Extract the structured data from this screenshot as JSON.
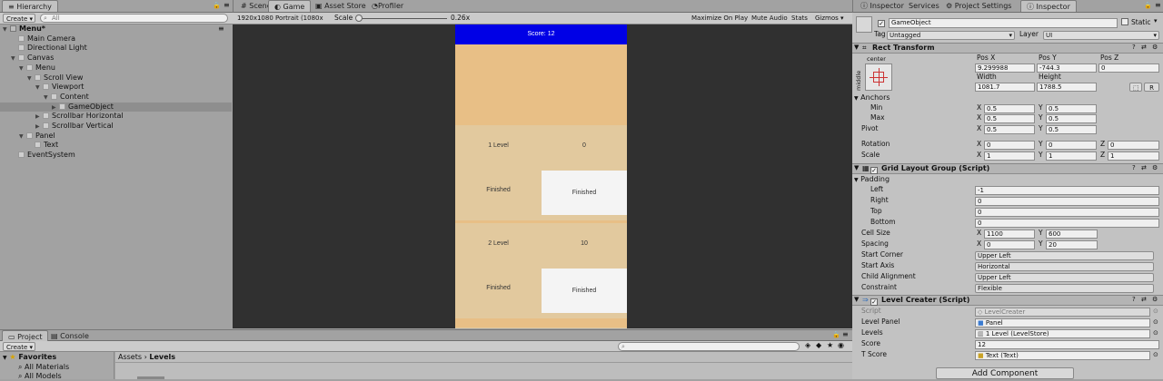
{
  "hierarchy": {
    "tab_label": "Hierarchy",
    "create_label": "Create",
    "search_placeholder": "All",
    "rows": [
      {
        "label": "Menu*",
        "depth": 0,
        "expand": "▼",
        "kind": "scene"
      },
      {
        "label": "Main Camera",
        "depth": 1,
        "expand": "",
        "kind": "obj"
      },
      {
        "label": "Directional Light",
        "depth": 1,
        "expand": "",
        "kind": "obj"
      },
      {
        "label": "Canvas",
        "depth": 1,
        "expand": "▼",
        "kind": "obj"
      },
      {
        "label": "Menu",
        "depth": 2,
        "expand": "▼",
        "kind": "obj"
      },
      {
        "label": "Scroll View",
        "depth": 3,
        "expand": "▼",
        "kind": "obj"
      },
      {
        "label": "Viewport",
        "depth": 4,
        "expand": "▼",
        "kind": "obj"
      },
      {
        "label": "Content",
        "depth": 5,
        "expand": "▼",
        "kind": "obj"
      },
      {
        "label": "GameObject",
        "depth": 6,
        "expand": "▶",
        "kind": "obj",
        "selected": true
      },
      {
        "label": "Scrollbar Horizontal",
        "depth": 4,
        "expand": "▶",
        "kind": "obj"
      },
      {
        "label": "Scrollbar Vertical",
        "depth": 4,
        "expand": "▶",
        "kind": "obj"
      },
      {
        "label": "Panel",
        "depth": 2,
        "expand": "▼",
        "kind": "obj"
      },
      {
        "label": "Text",
        "depth": 3,
        "expand": "",
        "kind": "obj"
      },
      {
        "label": "EventSystem",
        "depth": 1,
        "expand": "",
        "kind": "obj"
      }
    ]
  },
  "center_tabs": {
    "scene": "Scene",
    "game": "Game",
    "asset_store": "Asset Store",
    "profiler": "Profiler"
  },
  "game_toolbar": {
    "resolution": "1920x1080 Portrait (1080x",
    "scale_label": "Scale",
    "scale_value": "0.26x",
    "maximize": "Maximize On Play",
    "mute": "Mute Audio",
    "stats": "Stats",
    "gizmos": "Gizmos"
  },
  "game_view": {
    "score_text": "Score: 12",
    "levels": [
      {
        "name": "1 Level",
        "score": "0",
        "status_left": "Finished",
        "status_right": "Finished"
      },
      {
        "name": "2 Level",
        "score": "10",
        "status_left": "Finished",
        "status_right": "Finished"
      }
    ]
  },
  "inspector_tabs": {
    "inspector1": "Inspector",
    "services": "Services",
    "project_settings": "Project Settings",
    "inspector2": "Inspector"
  },
  "inspector": {
    "object_name": "GameObject",
    "static_label": "Static",
    "tag_label": "Tag",
    "tag_value": "Untagged",
    "layer_label": "Layer",
    "layer_value": "UI",
    "rect_transform": {
      "title": "Rect Transform",
      "anchor_preset_top": "center",
      "anchor_preset_side": "middle",
      "pos_x_label": "Pos X",
      "pos_y_label": "Pos Y",
      "pos_z_label": "Pos Z",
      "pos_x": "9.299988",
      "pos_y": "-744.3",
      "pos_z": "0",
      "width_label": "Width",
      "height_label": "Height",
      "width": "1081.7",
      "height": "1788.5",
      "r_button": "R",
      "anchors_label": "Anchors",
      "min_label": "Min",
      "min_x": "0.5",
      "min_y": "0.5",
      "max_label": "Max",
      "max_x": "0.5",
      "max_y": "0.5",
      "pivot_label": "Pivot",
      "pivot_x": "0.5",
      "pivot_y": "0.5",
      "rotation_label": "Rotation",
      "rot_x": "0",
      "rot_y": "0",
      "rot_z": "0",
      "scale_label": "Scale",
      "scale_x": "1",
      "scale_y": "1",
      "scale_z": "1"
    },
    "grid_layout": {
      "title": "Grid Layout Group (Script)",
      "padding_label": "Padding",
      "left_label": "Left",
      "left": "-1",
      "right_label": "Right",
      "right": "0",
      "top_label": "Top",
      "top": "0",
      "bottom_label": "Bottom",
      "bottom": "0",
      "cell_size_label": "Cell Size",
      "cell_x": "1100",
      "cell_y": "600",
      "spacing_label": "Spacing",
      "spacing_x": "0",
      "spacing_y": "20",
      "start_corner_label": "Start Corner",
      "start_corner": "Upper Left",
      "start_axis_label": "Start Axis",
      "start_axis": "Horizontal",
      "child_alignment_label": "Child Alignment",
      "child_alignment": "Upper Left",
      "constraint_label": "Constraint",
      "constraint": "Flexible"
    },
    "level_creater": {
      "title": "Level Creater (Script)",
      "script_label": "Script",
      "script_value": "LevelCreater",
      "level_panel_label": "Level Panel",
      "level_panel_value": "Panel",
      "levels_label": "Levels",
      "levels_value": "1 Level (LevelStore)",
      "score_label": "Score",
      "score_value": "12",
      "t_score_label": "T Score",
      "t_score_value": "Text (Text)"
    },
    "add_component": "Add Component"
  },
  "project": {
    "tab_project": "Project",
    "tab_console": "Console",
    "create_label": "Create",
    "favorites": "Favorites",
    "fav_items": [
      "All Materials",
      "All Models"
    ],
    "breadcrumb_root": "Assets",
    "breadcrumb_sep": "›",
    "breadcrumb_leaf": "Levels"
  },
  "colors": {
    "score_bar": "#0000e6",
    "panel_top": "#e8bf86",
    "level_bg": "#e2c99e",
    "game_bg": "#303030"
  }
}
